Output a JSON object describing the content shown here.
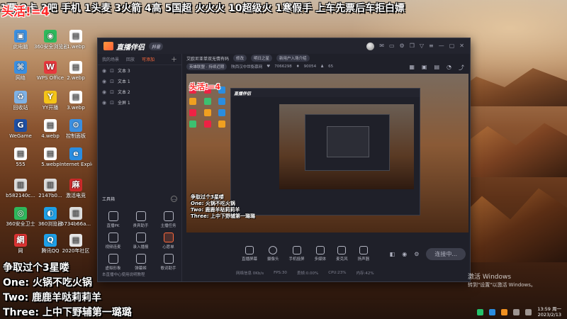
{
  "banner": {
    "text": "1票   2卡   3吧   手机   1头麦   3火箭   4高   5国超  火火火  10超级火  1寒假手  上车先票后车拒白嫖"
  },
  "count_overlay": "头活!=4",
  "desktop": {
    "icons": [
      {
        "name": "desktop-icon-this-pc",
        "label": "此电脑",
        "color": "#3b8fe0",
        "glyph": "▣"
      },
      {
        "name": "desktop-icon-360",
        "label": "360安全浏览器",
        "color": "#2eb85c",
        "glyph": "◉"
      },
      {
        "name": "desktop-icon-webp-1",
        "label": "1.webp",
        "color": "#ffffff",
        "glyph": "▤"
      },
      {
        "name": "desktop-icon-network",
        "label": "网络",
        "color": "#3b8fe0",
        "glyph": "⌘"
      },
      {
        "name": "desktop-icon-wps",
        "label": "WPS Office",
        "color": "#e8383d",
        "glyph": "W"
      },
      {
        "name": "desktop-icon-webp-2",
        "label": "2.webp",
        "color": "#ffffff",
        "glyph": "▤"
      },
      {
        "name": "desktop-icon-recycle",
        "label": "回收站",
        "color": "#7fb2e5",
        "glyph": "♻"
      },
      {
        "name": "desktop-icon-yy",
        "label": "YY开播",
        "color": "#f5c518",
        "glyph": "Y"
      },
      {
        "name": "desktop-icon-webp-3",
        "label": "3.webp",
        "color": "#ffffff",
        "glyph": "▤"
      },
      {
        "name": "desktop-icon-wegame",
        "label": "WeGame",
        "color": "#1e4fa3",
        "glyph": "G"
      },
      {
        "name": "desktop-icon-webp-4",
        "label": "4.webp",
        "color": "#ffffff",
        "glyph": "▤"
      },
      {
        "name": "desktop-icon-control",
        "label": "控制面板",
        "color": "#3b8fe0",
        "glyph": "⚙"
      },
      {
        "name": "desktop-icon-555",
        "label": "555",
        "color": "#ffffff",
        "glyph": "▤"
      },
      {
        "name": "desktop-icon-webp-5",
        "label": "5.webp",
        "color": "#ffffff",
        "glyph": "▤"
      },
      {
        "name": "desktop-icon-ie",
        "label": "Internet Explorer",
        "color": "#2a8de0",
        "glyph": "e"
      },
      {
        "name": "desktop-icon-img-1",
        "label": "b582140c...",
        "color": "#dddddd",
        "glyph": "▥"
      },
      {
        "name": "desktop-icon-img-2",
        "label": "2147b0...",
        "color": "#dddddd",
        "glyph": "▥"
      },
      {
        "name": "desktop-icon-mahjong",
        "label": "激活电竞",
        "color": "#cc2a2a",
        "glyph": "麻"
      },
      {
        "name": "desktop-icon-360-safe",
        "label": "360安全卫士",
        "color": "#2eb85c",
        "glyph": "◎"
      },
      {
        "name": "desktop-icon-360-browser",
        "label": "360浏览器",
        "color": "#1ea0e8",
        "glyph": "◐"
      },
      {
        "name": "desktop-icon-img-3",
        "label": "5734b66a...",
        "color": "#dddddd",
        "glyph": "▥"
      },
      {
        "name": "desktop-icon-wangyi",
        "label": "网",
        "color": "#d33",
        "glyph": "網"
      },
      {
        "name": "desktop-icon-qq",
        "label": "腾讯QQ",
        "color": "#1ea0e8",
        "glyph": "Q"
      },
      {
        "name": "desktop-icon-community",
        "label": "2020年社区",
        "color": "#e6e6e6",
        "glyph": "▤"
      }
    ]
  },
  "app": {
    "title": "直播伴侣",
    "version": "抖音",
    "scene_tabs": [
      "我的场景",
      "回放",
      "可添加"
    ],
    "sources": [
      {
        "label": "文本 3"
      },
      {
        "label": "文本 1"
      },
      {
        "label": "文本 2"
      },
      {
        "label": "全屏 1"
      }
    ],
    "toolbox_label": "工具箱",
    "tools": [
      {
        "name": "tool-pk",
        "label": "直播PK"
      },
      {
        "name": "tool-lianmai",
        "label": "贵宾助手"
      },
      {
        "name": "tool-host",
        "label": "主播任务"
      },
      {
        "name": "tool-video",
        "label": "视频连麦"
      },
      {
        "name": "tool-import",
        "label": "录入播报"
      },
      {
        "name": "tool-wish",
        "label": "心愿单",
        "highlight": true
      },
      {
        "name": "tool-avatar",
        "label": "虚拟形象"
      },
      {
        "name": "tool-danmaku",
        "label": "弹幕姬"
      },
      {
        "name": "tool-song",
        "label": "歌词助手"
      }
    ],
    "announcement": "本直播中心使用说明教程",
    "stream_info": {
      "title": "艾欧尼亚单双无情有码",
      "edit_btn": "修改",
      "game_btn": "明日之星",
      "rank_btn": "新用户入场介绍",
      "category": "英雄联盟 · 持续近期",
      "location": "陕西汉中世衡慕网",
      "fans": "7066298",
      "likes": "90054",
      "viewers": "65"
    },
    "preview_overlay": "争取过个3星喽\nOne: 火锅不吃火锅\nTwo: 鹿鹿羊哒莉莉羊\nThree: 上中下野辅第一璐璐",
    "bottom_buttons": [
      {
        "name": "btn-stream-screen",
        "label": "直播屏幕"
      },
      {
        "name": "btn-camera",
        "label": "摄像头",
        "round": true
      },
      {
        "name": "btn-phone",
        "label": "手机投屏"
      },
      {
        "name": "btn-multi",
        "label": "多媒体"
      },
      {
        "name": "btn-mic",
        "label": "麦克风"
      },
      {
        "name": "btn-speaker",
        "label": "扬声器"
      }
    ],
    "live_button": "连接中...",
    "status_bar": [
      "网络信息 0Kb/s",
      "FPS:30",
      "丢帧:0.00%",
      "CPU:23%",
      "内存:42%"
    ]
  },
  "small_count": "头活!=4",
  "overlay": {
    "line1": "争取过个3星喽",
    "line2": "One: 火锅不吃火锅",
    "line3": "Two: 鹿鹿羊哒莉莉羊",
    "line4": "Three: 上中下野辅第一璐璐"
  },
  "watermark": {
    "title": "激活 Windows",
    "subtitle": "转到\"设置\"以激活 Windows。"
  },
  "tray": {
    "time": "13:59 周一",
    "date": "2023/2/13"
  }
}
